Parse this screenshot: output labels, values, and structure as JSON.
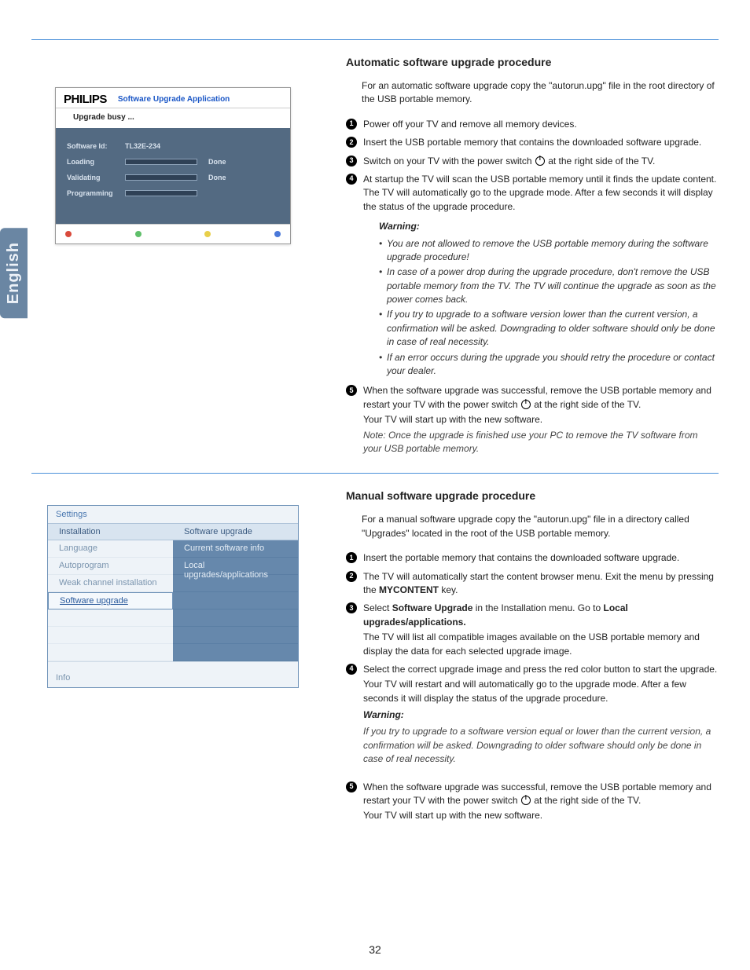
{
  "page_number": "32",
  "language_tab": "English",
  "section1": {
    "heading": "Automatic software upgrade procedure",
    "intro": "For an automatic software upgrade copy the \"autorun.upg\" file in the root directory of the USB portable memory.",
    "steps": {
      "s1": "Power off your TV and remove all memory devices.",
      "s2": "Insert the USB portable memory that contains the downloaded software upgrade.",
      "s3a": "Switch on your TV with the power switch ",
      "s3b": " at the right side of the TV.",
      "s4": "At startup the TV will scan the USB portable memory until it finds the update content. The TV will automatically go to the upgrade mode. After a few seconds it will display the status of the upgrade procedure.",
      "s5a": "When the software upgrade was successful, remove the USB portable memory and restart your TV with the power switch ",
      "s5b": " at the right side of the TV.",
      "s5c": "Your TV will start up with the new software.",
      "s5note": "Note: Once the upgrade is finished use your PC to remove the TV software from your USB portable memory."
    },
    "warning": {
      "title": "Warning:",
      "w1": "You are not allowed to remove the USB portable memory during the software upgrade procedure!",
      "w2": "In case of a power drop during the upgrade procedure, don't remove the USB portable memory from the TV. The TV will continue the upgrade as soon as the power comes back.",
      "w3": "If you try to upgrade to a software version lower than the current version, a confirmation will be asked. Downgrading to older software should only be done in case of real necessity.",
      "w4": "If an error occurs during the upgrade you should retry the procedure or contact your dealer."
    }
  },
  "fig1": {
    "brand": "PHILIPS",
    "app_title": "Software Upgrade Application",
    "busy": "Upgrade busy ...",
    "row_id_label": "Software Id:",
    "row_id_value": "TL32E-234",
    "row_loading": "Loading",
    "row_validating": "Validating",
    "row_programming": "Programming",
    "done": "Done"
  },
  "section2": {
    "heading": "Manual software upgrade procedure",
    "intro": "For a manual software upgrade copy the \"autorun.upg\" file in a directory called \"Upgrades\" located in the root of the USB portable memory.",
    "steps": {
      "s1": "Insert the portable memory that contains the downloaded software upgrade.",
      "s2a": "The TV will automatically start the content browser menu. Exit the menu by pressing the ",
      "s2b": "MYCONTENT",
      "s2c": " key.",
      "s3a": "Select ",
      "s3b": "Software Upgrade",
      "s3c": " in the Installation menu. Go to ",
      "s3d": "Local upgrades/applications.",
      "s3e": "The TV will list all compatible images available on the USB portable memory and display the data for each selected upgrade image.",
      "s4a": "Select the correct upgrade image and press the red color button to start the upgrade.",
      "s4b": "Your TV will restart and will automatically go to the upgrade mode. After a few seconds it will display the status of the upgrade procedure.",
      "s4warn_title": "Warning:",
      "s4warn": "If you try to upgrade to a software version equal or lower than the current version, a confirmation will be asked. Downgrading to older software should only be done in case of real necessity.",
      "s5a": "When the software upgrade was successful, remove the USB portable memory and restart your TV with the power switch ",
      "s5b": " at the right side of the TV.",
      "s5c": "Your TV will start up with the new software."
    }
  },
  "fig2": {
    "title": "Settings",
    "col1_head": "Installation",
    "col2_head": "Software upgrade",
    "col1": {
      "r1": "Language",
      "r2": "Autoprogram",
      "r3": "Weak channel installation",
      "r4": "Software upgrade"
    },
    "col2": {
      "r1": "Current software info",
      "r2": "Local upgrades/applications"
    },
    "footer": "Info"
  }
}
